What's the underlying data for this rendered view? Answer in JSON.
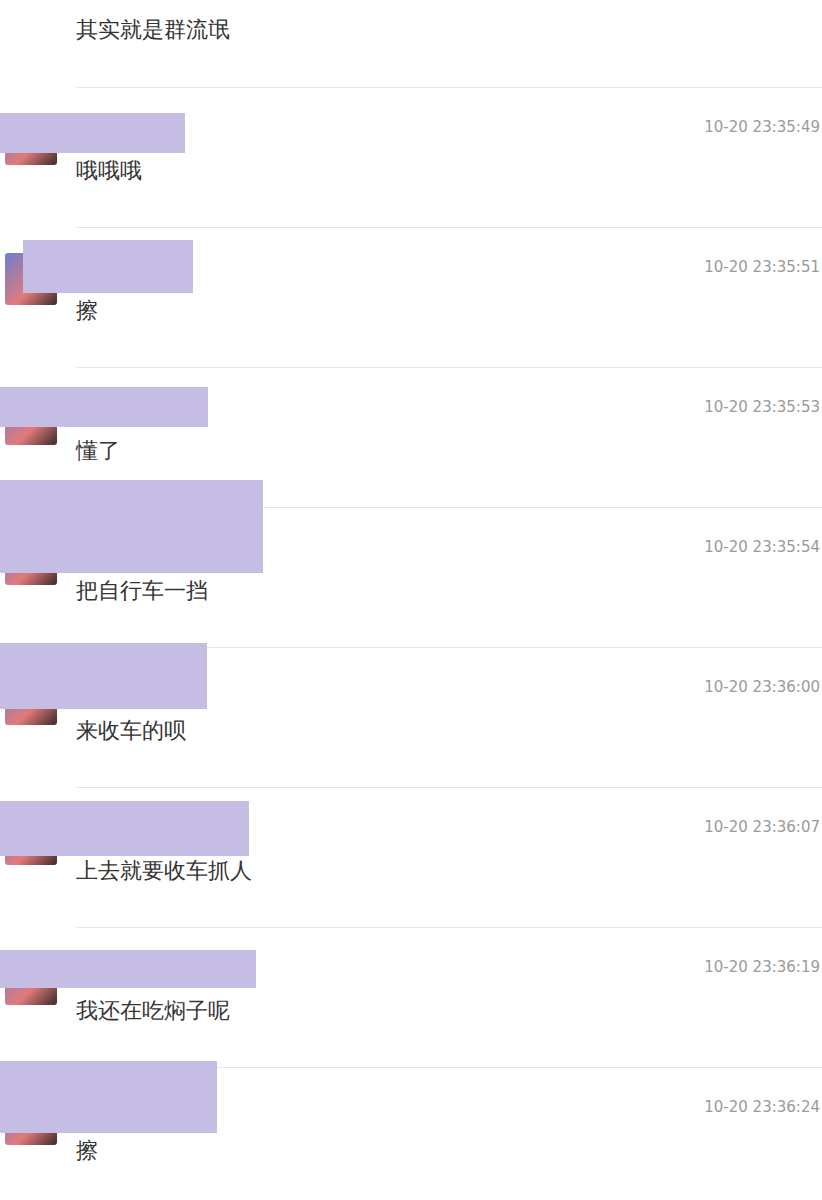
{
  "partial_message": {
    "text": "其实就是群流氓"
  },
  "messages": [
    {
      "time": "10-20 23:35:49",
      "text": "哦哦哦"
    },
    {
      "time": "10-20 23:35:51",
      "text": "擦"
    },
    {
      "time": "10-20 23:35:53",
      "text": "懂了"
    },
    {
      "time": "10-20 23:35:54",
      "text": "把自行车一挡"
    },
    {
      "time": "10-20 23:36:00",
      "text": "来收车的呗"
    },
    {
      "time": "10-20 23:36:07",
      "text": "上去就要收车抓人"
    },
    {
      "time": "10-20 23:36:19",
      "text": "我还在吃焖子呢"
    },
    {
      "time": "10-20 23:36:24",
      "text": "擦"
    }
  ]
}
